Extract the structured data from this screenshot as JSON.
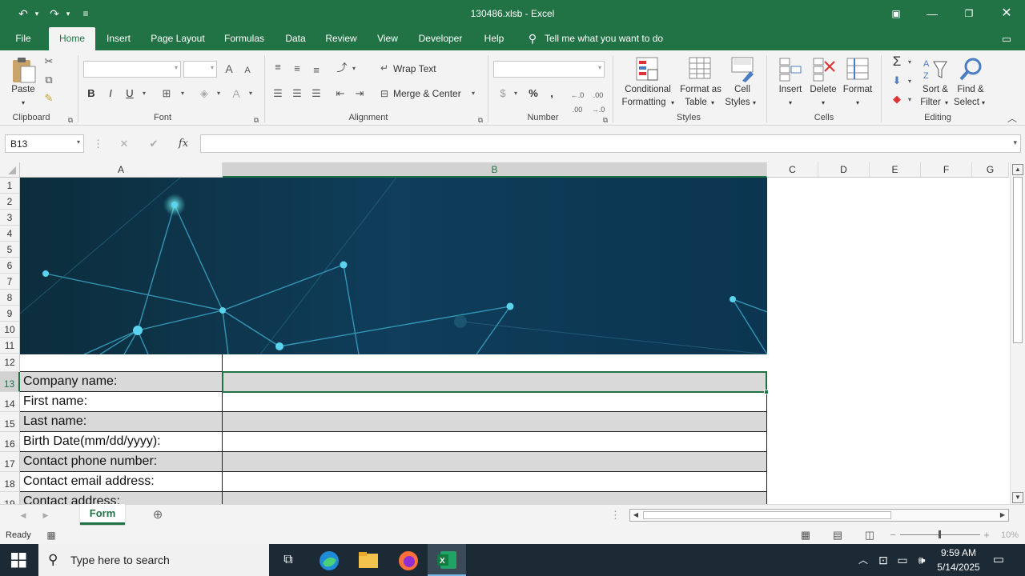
{
  "window": {
    "title": "130486.xlsb  -  Excel",
    "undo_icon": "undo-icon",
    "redo_icon": "redo-icon"
  },
  "tabs": [
    "File",
    "Home",
    "Insert",
    "Page Layout",
    "Formulas",
    "Data",
    "Review",
    "View",
    "Developer",
    "Help"
  ],
  "active_tab": "Home",
  "tell_me": "Tell me what you want to do",
  "ribbon": {
    "clipboard": {
      "label": "Clipboard",
      "paste": "Paste"
    },
    "font": {
      "label": "Font",
      "bold": "B",
      "italic": "I",
      "underline": "U",
      "grow": "A",
      "shrink": "A"
    },
    "alignment": {
      "label": "Alignment",
      "wrap": "Wrap Text",
      "merge": "Merge & Center"
    },
    "number": {
      "label": "Number",
      "currency": "$",
      "percent": "%",
      "comma": ",",
      "inc": "←.0 .00",
      "dec": ".00 →.0"
    },
    "styles": {
      "label": "Styles",
      "conditional": "Conditional",
      "conditional2": "Formatting",
      "format_table": "Format as",
      "format_table2": "Table",
      "cell_styles": "Cell",
      "cell_styles2": "Styles"
    },
    "cells": {
      "label": "Cells",
      "insert": "Insert",
      "delete": "Delete",
      "format": "Format"
    },
    "editing": {
      "label": "Editing",
      "sort": "Sort &",
      "sort2": "Filter",
      "find": "Find &",
      "find2": "Select"
    }
  },
  "formula_bar": {
    "name_box": "B13",
    "cancel": "✕",
    "enter": "✔",
    "fx": "fx",
    "value": ""
  },
  "columns": [
    "A",
    "B",
    "C",
    "D",
    "E",
    "F",
    "G"
  ],
  "rows": [
    "1",
    "2",
    "3",
    "4",
    "5",
    "6",
    "7",
    "8",
    "9",
    "10",
    "11",
    "12",
    "13",
    "14",
    "15",
    "16",
    "17",
    "18",
    "19"
  ],
  "form_labels": [
    "Company name:",
    "First name:",
    "Last name:",
    "Birth Date(mm/dd/yyyy):",
    "Contact phone number:",
    "Contact email address:",
    "Contact address:"
  ],
  "sheet_tabs": [
    "Form"
  ],
  "status": {
    "ready": "Ready",
    "zoom": "10%"
  },
  "taskbar": {
    "search_placeholder": "Type here to search",
    "time": "9:59 AM",
    "date": "5/14/2025"
  },
  "colors": {
    "excel_green": "#217346",
    "banner": "#0f3a55",
    "taskbar": "#1c2a36"
  }
}
